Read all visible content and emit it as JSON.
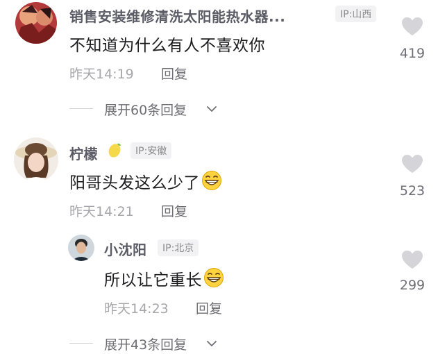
{
  "comments": [
    {
      "username": "销售安装维修清洗太阳能热水器...",
      "ip": "IP:山西",
      "text": "不知道为什么有人不喜欢你",
      "time": "昨天14:19",
      "reply": "回复",
      "likes": "419",
      "expand": "展开60条回复"
    },
    {
      "username": "柠檬",
      "ip": "IP:安徽",
      "text": "阳哥头发这么少了",
      "time": "昨天14:21",
      "reply": "回复",
      "likes": "523"
    },
    {
      "username": "小沈阳",
      "ip": "IP:北京",
      "text": "所以让它重长",
      "time": "昨天14:23",
      "reply": "回复",
      "likes": "299",
      "expand": "展开43条回复"
    }
  ],
  "icons": [
    "heart-icon",
    "grin-emoji-icon",
    "lemon-emoji-icon",
    "chevron-down-icon"
  ],
  "colors": {
    "heart": "#d5d5d9",
    "username": "#5b5b66",
    "text": "#1c1c1e",
    "meta": "#a6a6ab"
  }
}
